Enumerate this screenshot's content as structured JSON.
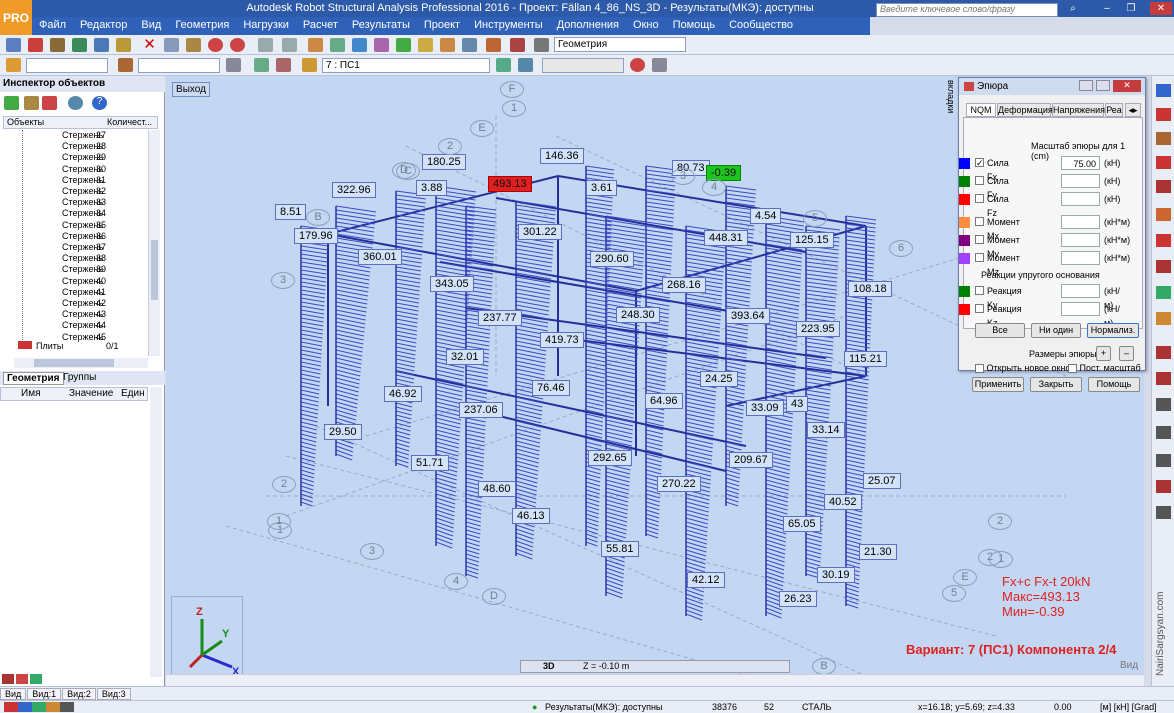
{
  "app": {
    "title": "Autodesk Robot Structural Analysis Professional 2016 - Проект: Fällan 4_86_NS_3D - Результаты(МКЭ): доступны",
    "logo": "PRO",
    "search_placeholder": "Введите ключевое слово/фразу"
  },
  "menu": [
    "Файл",
    "Редактор",
    "Вид",
    "Геометрия",
    "Нагрузки",
    "Расчет",
    "Результаты",
    "Проект",
    "Инструменты",
    "Дополнения",
    "Окно",
    "Помощь",
    "Сообщество"
  ],
  "toolbar": {
    "geometry_combo": "Геометрия",
    "case_combo": "7 : ПС1"
  },
  "inspector": {
    "title": "Инспектор объектов",
    "col_objects": "Объекты",
    "col_count": "Количест...",
    "rows": [
      {
        "name": "Стержень",
        "n": "27"
      },
      {
        "name": "Стержень",
        "n": "28"
      },
      {
        "name": "Стержень",
        "n": "29"
      },
      {
        "name": "Стержень",
        "n": "30"
      },
      {
        "name": "Стержень",
        "n": "31"
      },
      {
        "name": "Стержень",
        "n": "32"
      },
      {
        "name": "Стержень",
        "n": "33"
      },
      {
        "name": "Стержень",
        "n": "34"
      },
      {
        "name": "Стержень",
        "n": "35"
      },
      {
        "name": "Стержень",
        "n": "36"
      },
      {
        "name": "Стержень",
        "n": "37"
      },
      {
        "name": "Стержень",
        "n": "38"
      },
      {
        "name": "Стержень",
        "n": "39"
      },
      {
        "name": "Стержень",
        "n": "40"
      },
      {
        "name": "Стержень",
        "n": "41"
      },
      {
        "name": "Стержень",
        "n": "42"
      },
      {
        "name": "Стержень",
        "n": "43"
      },
      {
        "name": "Стержень",
        "n": "44"
      },
      {
        "name": "Стержень",
        "n": "45"
      }
    ],
    "plates": {
      "name": "Плиты",
      "n": "0/1"
    },
    "tab_geometry": "Геометрия",
    "tab_groups": "Группы",
    "col_name": "Имя",
    "col_value": "Значение",
    "col_unit": "Един"
  },
  "viewport": {
    "exit": "Выход",
    "view_mode": "3D",
    "z_level": "Z = -0.10 m",
    "view_label": "Вид",
    "legend": {
      "line1": "Fx+c Fx-t  20kN",
      "line2": "Макс=493.13",
      "line3": "Мин=-0.39"
    },
    "variant": "Вариант: 7 (ПС1) Компонента 2/4",
    "watermark": "NairiSargsyan.com",
    "max_label": "493.13",
    "min_label": "-0.39",
    "values": [
      "180.25",
      "146.36",
      "322.96",
      "3.88",
      "3.61",
      "80.73",
      "8.51",
      "301.22",
      "4.54",
      "179.96",
      "448.31",
      "125.15",
      "360.01",
      "290.60",
      "343.05",
      "268.16",
      "108.18",
      "237.77",
      "248.30",
      "393.64",
      "223.95",
      "419.73",
      "32.01",
      "115.21",
      "76.46",
      "24.25",
      "46.92",
      "64.96",
      "33.09",
      "43",
      "237.06",
      "33.14",
      "29.50",
      "292.65",
      "209.67",
      "51.71",
      "270.22",
      "48.60",
      "25.07",
      "40.52",
      "46.13",
      "65.05",
      "55.81",
      "21.30",
      "42.12",
      "30.19",
      "26.23"
    ],
    "grid": [
      "F",
      "1",
      "E",
      "2",
      "D",
      "C",
      "3",
      "4",
      "B",
      "5",
      "3",
      "6",
      "2",
      "1",
      "1",
      "2",
      "2",
      "3",
      "4",
      "D",
      "5",
      "E",
      "B",
      "1"
    ]
  },
  "dialog": {
    "title": "Эпюра",
    "tabs": [
      "NQM",
      "Деформация",
      "Напряжения",
      "Реа"
    ],
    "scale_label": "Масштаб эпюры для 1  (cm)",
    "items": [
      {
        "label": "Сила Fx",
        "color": "#0000ff",
        "checked": true,
        "value": "75.00",
        "unit": "(кН)"
      },
      {
        "label": "Сила Fy",
        "color": "#008000",
        "checked": false,
        "value": "",
        "unit": "(кН)"
      },
      {
        "label": "Сила Fz",
        "color": "#ff0000",
        "checked": false,
        "value": "",
        "unit": "(кН)"
      },
      {
        "label": "Момент Mx",
        "color": "#ff8c40",
        "checked": false,
        "value": "",
        "unit": "(кН*м)"
      },
      {
        "label": "Момент My",
        "color": "#800080",
        "checked": false,
        "value": "",
        "unit": "(кН*м)"
      },
      {
        "label": "Момент Mz",
        "color": "#a040ff",
        "checked": false,
        "value": "",
        "unit": "(кН*м)"
      }
    ],
    "reactions_label": "Реакции упругого основания",
    "reactions": [
      {
        "label": "Реакция Ky",
        "color": "#008000",
        "unit": "(кН/м)"
      },
      {
        "label": "Реакция Kz",
        "color": "#ff0000",
        "unit": "(кН/м)"
      }
    ],
    "btn_all": "Все",
    "btn_none": "Ни один",
    "btn_normalize": "Нормализ.",
    "sizes_label": "Размеры эпюры:",
    "plus": "+",
    "minus": "–",
    "open_new": "Открыть новое окно",
    "const_scale": "Пост. масштаб",
    "apply": "Применить",
    "close": "Закрыть",
    "help": "Помощь",
    "side_tab": "вкладки"
  },
  "status": {
    "view_tabs": [
      "Вид",
      "Вид:1",
      "Вид:2",
      "Вид:3"
    ],
    "results": "Результаты(МКЭ): доступны",
    "n1": "38376",
    "n2": "52",
    "material": "СТАЛЬ",
    "coords": "x=16.18; y=5.69; z=4.33",
    "angle": "0.00",
    "units": "[м] [кН] [Grad]"
  }
}
